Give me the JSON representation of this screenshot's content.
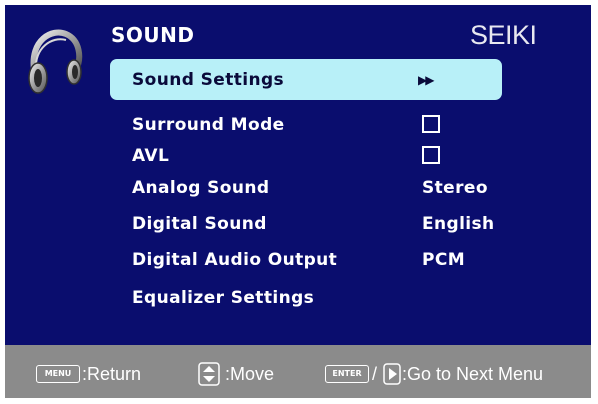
{
  "menu": {
    "title": "SOUND",
    "brand": "SEIKI",
    "items": [
      {
        "label": "Sound Settings",
        "value": "",
        "indicator": "next-arrows",
        "selected": true
      },
      {
        "label": "Surround Mode",
        "value": "",
        "indicator": "checkbox",
        "checked": false
      },
      {
        "label": "AVL",
        "value": "",
        "indicator": "checkbox",
        "checked": false
      },
      {
        "label": "Analog Sound",
        "value": "Stereo"
      },
      {
        "label": "Digital Sound",
        "value": "English"
      },
      {
        "label": "Digital Audio Output",
        "value": "PCM"
      },
      {
        "label": "Equalizer Settings",
        "value": ""
      }
    ]
  },
  "footer": {
    "menu_key": "MENU",
    "return_label": ":Return",
    "move_label": ":Move",
    "enter_key": "ENTER",
    "separator": "/",
    "next_label": ":Go to Next Menu"
  },
  "colors": {
    "panel_bg": "#0a0d6e",
    "highlight": "#b8f0f8",
    "footer_bg": "#8b8b8b",
    "text": "#ffffff"
  },
  "icons": [
    "headphones-icon",
    "next-arrows-icon",
    "up-down-icon",
    "right-arrow-icon"
  ]
}
